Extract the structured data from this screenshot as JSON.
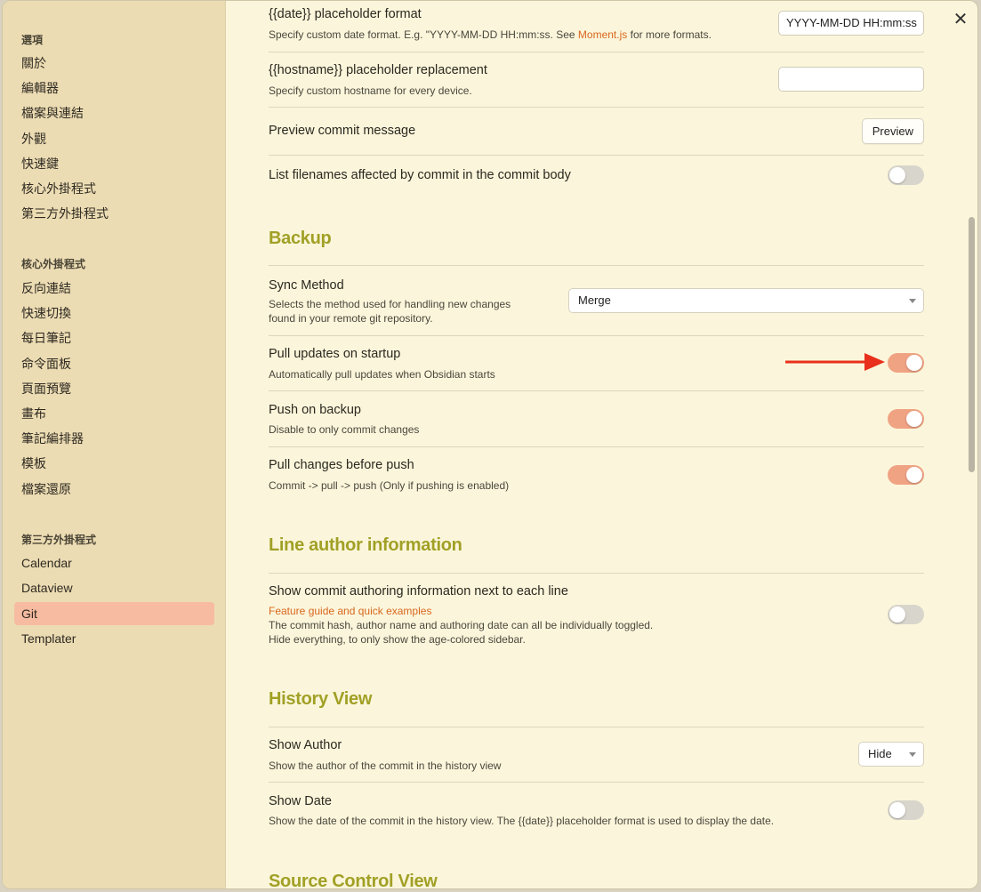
{
  "colors": {
    "accent": "#f0a383",
    "heading": "#a1a026",
    "link": "#d9661e",
    "sidebar_active": "#f6bba0",
    "arrow": "#e8301c"
  },
  "sidebar": {
    "sections": [
      {
        "title": "選項",
        "items": [
          "關於",
          "編輯器",
          "檔案與連結",
          "外觀",
          "快速鍵",
          "核心外掛程式",
          "第三方外掛程式"
        ]
      },
      {
        "title": "核心外掛程式",
        "items": [
          "反向連結",
          "快速切換",
          "每日筆記",
          "命令面板",
          "頁面預覽",
          "畫布",
          "筆記編排器",
          "模板",
          "檔案還原"
        ]
      },
      {
        "title": "第三方外掛程式",
        "items": [
          "Calendar",
          "Dataview",
          "Git",
          "Templater"
        ]
      }
    ],
    "active_item": "Git"
  },
  "settings": {
    "date_format": {
      "title": "{{date}} placeholder format",
      "desc_before": "Specify custom date format. E.g. \"YYYY-MM-DD HH:mm:ss. See ",
      "desc_link": "Moment.js",
      "desc_after": " for more formats.",
      "value": "YYYY-MM-DD HH:mm:ss"
    },
    "hostname": {
      "title": "{{hostname}} placeholder replacement",
      "desc": "Specify custom hostname for every device.",
      "value": ""
    },
    "preview_commit": {
      "title": "Preview commit message",
      "button": "Preview"
    },
    "list_filenames": {
      "title": "List filenames affected by commit in the commit body",
      "enabled": false
    }
  },
  "backup": {
    "heading": "Backup",
    "sync_method": {
      "title": "Sync Method",
      "desc_line1": "Selects the method used for handling new changes",
      "desc_line2": "found in your remote git repository.",
      "value": "Merge"
    },
    "pull_on_startup": {
      "title": "Pull updates on startup",
      "desc": "Automatically pull updates when Obsidian starts",
      "enabled": true
    },
    "push_on_backup": {
      "title": "Push on backup",
      "desc": "Disable to only commit changes",
      "enabled": true
    },
    "pull_before_push": {
      "title": "Pull changes before push",
      "desc": "Commit -> pull -> push (Only if pushing is enabled)",
      "enabled": true
    }
  },
  "line_author": {
    "heading": "Line author information",
    "show_info": {
      "title": "Show commit authoring information next to each line",
      "link": "Feature guide and quick examples",
      "desc_line1": "The commit hash, author name and authoring date can all be individually toggled.",
      "desc_line2": "Hide everything, to only show the age-colored sidebar.",
      "enabled": false
    }
  },
  "history_view": {
    "heading": "History View",
    "show_author": {
      "title": "Show Author",
      "desc": "Show the author of the commit in the history view",
      "value": "Hide"
    },
    "show_date": {
      "title": "Show Date",
      "desc": "Show the date of the commit in the history view. The {{date}} placeholder format is used to display the date.",
      "enabled": false
    }
  },
  "source_control": {
    "heading": "Source Control View"
  },
  "window": {
    "close_icon": "close-icon"
  }
}
